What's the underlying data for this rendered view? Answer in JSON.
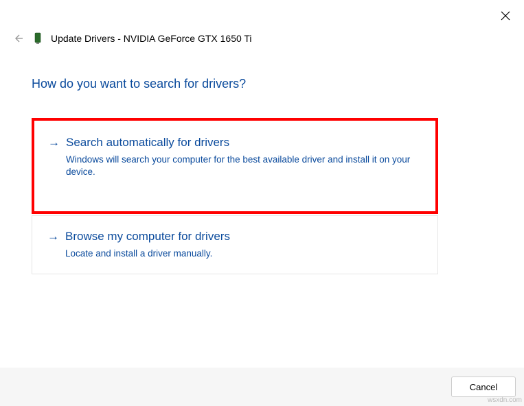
{
  "window": {
    "title": "Update Drivers - NVIDIA GeForce GTX 1650 Ti"
  },
  "heading": "How do you want to search for drivers?",
  "options": [
    {
      "title": "Search automatically for drivers",
      "description": "Windows will search your computer for the best available driver and install it on your device."
    },
    {
      "title": "Browse my computer for drivers",
      "description": "Locate and install a driver manually."
    }
  ],
  "footer": {
    "cancel_label": "Cancel"
  },
  "watermark": "wsxdn.com"
}
